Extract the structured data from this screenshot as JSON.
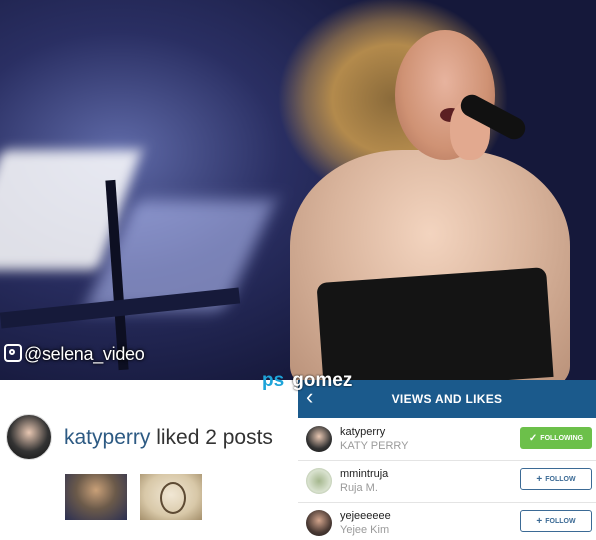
{
  "photo": {
    "instagram_handle": "@selena_video"
  },
  "watermark": {
    "part1": "ps",
    "part2": "gomez"
  },
  "notification": {
    "username": "katyperry",
    "action_text": "liked 2 posts"
  },
  "views_panel": {
    "title": "VIEWS AND LIKES",
    "back_icon": "chevron-left-icon",
    "rows": [
      {
        "username": "katyperry",
        "name": "KATY PERRY",
        "button_label": "FOLLOWING",
        "button_icon": "✓"
      },
      {
        "username": "mmintruja",
        "name": "Ruja M.",
        "button_label": "FOLLOW",
        "button_icon": "+"
      },
      {
        "username": "yejeeeeee",
        "name": "Yejee Kim",
        "button_label": "FOLLOW",
        "button_icon": "+"
      }
    ]
  },
  "colors": {
    "header_blue": "#1b5a8c",
    "following_green": "#6cc04a",
    "username_blue": "#2d5a83",
    "watermark_blue": "#1ea4d9"
  }
}
